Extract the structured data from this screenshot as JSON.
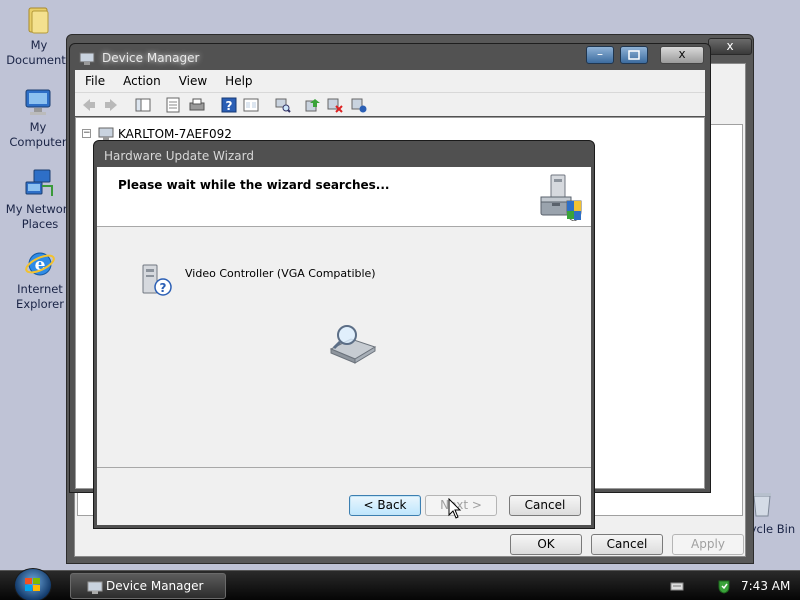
{
  "desktop": {
    "icons": [
      {
        "label_line1": "My",
        "label_line2": "Documents"
      },
      {
        "label_line1": "My Computer",
        "label_line2": ""
      },
      {
        "label_line1": "My Network",
        "label_line2": "Places"
      },
      {
        "label_line1": "Internet",
        "label_line2": "Explorer"
      },
      {
        "label_line1": "Recycle Bin",
        "label_line2": ""
      }
    ]
  },
  "system_properties": {
    "close_label": "x",
    "ok_label": "OK",
    "cancel_label": "Cancel",
    "apply_label": "Apply"
  },
  "device_manager": {
    "title": "Device Manager",
    "minimize_label": "–",
    "close_label": "x",
    "menu": [
      "File",
      "Action",
      "View",
      "Help"
    ],
    "tree_expander": "−",
    "tree_root": "KARLTOM-7AEF092"
  },
  "wizard": {
    "title": "Hardware Update Wizard",
    "header_text": "Please wait while the wizard searches...",
    "device_name": "Video Controller (VGA Compatible)",
    "back_label": "< Back",
    "next_label": "Next >",
    "cancel_label": "Cancel"
  },
  "taskbar": {
    "task_label": "Device Manager",
    "clock": "7:43 AM"
  }
}
